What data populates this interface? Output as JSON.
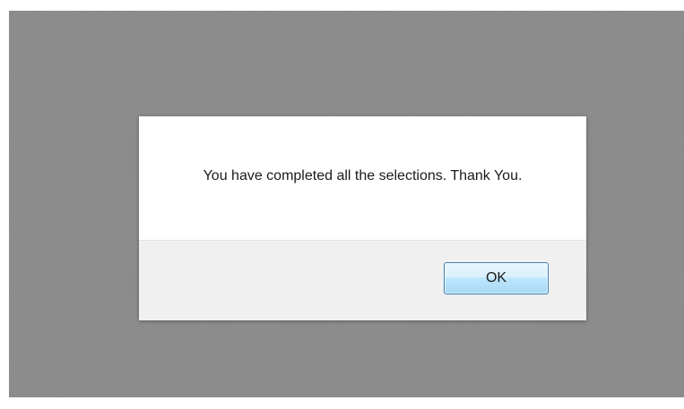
{
  "dialog": {
    "message": "You have completed all the selections. Thank You.",
    "ok_label": "OK"
  },
  "colors": {
    "overlay": "#8c8c8c",
    "dialog_body": "#ffffff",
    "dialog_footer": "#f0f0f0",
    "button_border": "#3c7fb1"
  }
}
